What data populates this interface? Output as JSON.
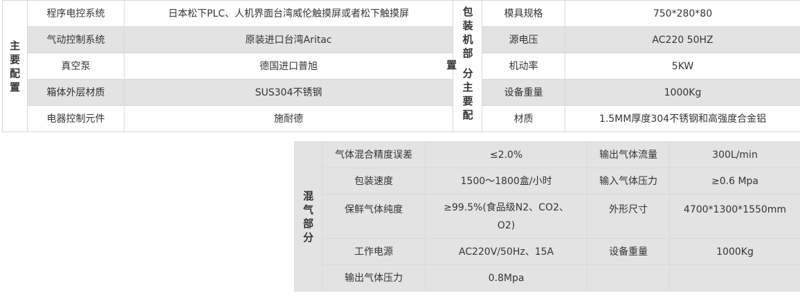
{
  "main_config": {
    "section_title": "主要配置",
    "rows": [
      {
        "label": "程序电控系统",
        "value": "日本松下PLC、人机界面台湾威伦触摸屏或者松下触摸屏"
      },
      {
        "label": "气动控制系统",
        "value": "原装进口台湾Aritac"
      },
      {
        "label": "真空泵",
        "value": "德国进口普旭"
      },
      {
        "label": "箱体外层材质",
        "value": "SUS304不锈钢"
      },
      {
        "label": "电器控制元件",
        "value": "施耐德"
      }
    ],
    "side_title_part1": "包装机部",
    "side_title_char": "置",
    "side_title_part2": "分主要配",
    "side_rows": [
      {
        "label": "模具规格",
        "value": "750*280*80"
      },
      {
        "label": "源电压",
        "value": "AC220 50HZ"
      },
      {
        "label": "机动率",
        "value": "5KW"
      },
      {
        "label": "设备重量",
        "value": "1000Kg"
      },
      {
        "label": "材质",
        "value": "1.5MM厚度304不锈钢和高强度合金铝"
      }
    ]
  },
  "mixing_section": {
    "section_title": "混气部分",
    "rows": [
      {
        "label1": "气体混合精度误差",
        "value1": "≤2.0%",
        "label2": "输出气体流量",
        "value2": "300L/min"
      },
      {
        "label1": "包装速度",
        "value1": "1500～1800盒/小时",
        "label2": "输入气体压力",
        "value2": "≥0.6 Mpa"
      },
      {
        "label1": "保鲜气体纯度",
        "value1": "≥99.5%(食品级N2、CO2、O2)",
        "label2": "外形尺寸",
        "value2": "4700*1300*1550mm"
      },
      {
        "label1": "工作电源",
        "value1": "AC220V/50Hz、15A",
        "label2": "设备重量",
        "value2": "1000Kg"
      },
      {
        "label1": "输出气体压力",
        "value1": "0.8Mpa",
        "label2": "",
        "value2": ""
      }
    ]
  },
  "colors": {
    "grey_row": "#e3e3e3",
    "border": "#d9d9d9",
    "text": "#333333"
  }
}
